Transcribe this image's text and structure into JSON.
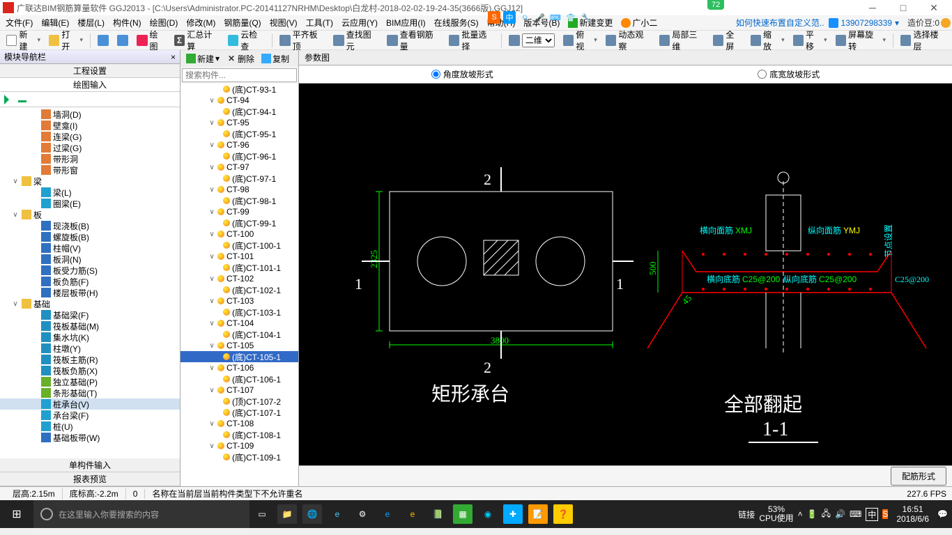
{
  "title": "广联达BIM钢筋算量软件 GGJ2013 - [C:\\Users\\Administrator.PC-20141127NRHM\\Desktop\\白龙村-2018-02-02-19-24-35(3666版).GGJ12]",
  "floatnum": "72",
  "menu": [
    "文件(F)",
    "编辑(E)",
    "楼层(L)",
    "构件(N)",
    "绘图(D)",
    "修改(M)",
    "钢筋量(Q)",
    "视图(V)",
    "工具(T)",
    "云应用(Y)",
    "BIM应用(I)",
    "在线服务(S)",
    "帮助(H)",
    "版本号(B)"
  ],
  "menu_link": "如何快速布置自定义范..",
  "menu_newbtn": "新建变更",
  "menu_gx": "广小二",
  "user_id": "13907298339",
  "bean_label": "造价豆:0",
  "toolbar1": {
    "new": "新建",
    "open": "打开",
    "draw": "绘图",
    "sum": "汇总计算",
    "cloud": "云检查",
    "flat": "平齐板顶",
    "find": "查找图元",
    "steel": "查看钢筋量",
    "batch": "批量选择",
    "dim": "二维",
    "bird": "俯视",
    "dyn": "动态观察",
    "local": "局部三维",
    "full": "全屏",
    "zoom": "缩放",
    "pan": "平移",
    "rot": "屏幕旋转",
    "floor": "选择楼层"
  },
  "leftpanel": {
    "title": "模块导航栏",
    "tab1": "工程设置",
    "tab2": "绘图输入"
  },
  "nav_items": [
    {
      "ind": 36,
      "ico": "#e27b38",
      "t": "墙洞(D)"
    },
    {
      "ind": 36,
      "ico": "#e27b38",
      "t": "壁龛(I)"
    },
    {
      "ind": 36,
      "ico": "#e27b38",
      "t": "连梁(G)"
    },
    {
      "ind": 36,
      "ico": "#e27b38",
      "t": "过梁(G)"
    },
    {
      "ind": 36,
      "ico": "#e27b38",
      "t": "带形洞"
    },
    {
      "ind": 36,
      "ico": "#e27b38",
      "t": "带形窗"
    },
    {
      "ind": 8,
      "exp": "∨",
      "ico": "#f0c040",
      "t": "梁",
      "folder": 1
    },
    {
      "ind": 36,
      "ico": "#20a0d0",
      "t": "梁(L)"
    },
    {
      "ind": 36,
      "ico": "#20a0d0",
      "t": "圈梁(E)"
    },
    {
      "ind": 8,
      "exp": "∨",
      "ico": "#f0c040",
      "t": "板",
      "folder": 1
    },
    {
      "ind": 36,
      "ico": "#3070c0",
      "t": "现浇板(B)"
    },
    {
      "ind": 36,
      "ico": "#3070c0",
      "t": "螺旋板(B)"
    },
    {
      "ind": 36,
      "ico": "#3070c0",
      "t": "柱帽(V)"
    },
    {
      "ind": 36,
      "ico": "#3070c0",
      "t": "板洞(N)"
    },
    {
      "ind": 36,
      "ico": "#3070c0",
      "t": "板受力筋(S)"
    },
    {
      "ind": 36,
      "ico": "#3070c0",
      "t": "板负筋(F)"
    },
    {
      "ind": 36,
      "ico": "#3070c0",
      "t": "楼层板带(H)"
    },
    {
      "ind": 8,
      "exp": "∨",
      "ico": "#f0c040",
      "t": "基础",
      "folder": 1
    },
    {
      "ind": 36,
      "ico": "#2090c0",
      "t": "基础梁(F)"
    },
    {
      "ind": 36,
      "ico": "#2090c0",
      "t": "筏板基础(M)"
    },
    {
      "ind": 36,
      "ico": "#2090c0",
      "t": "集水坑(K)"
    },
    {
      "ind": 36,
      "ico": "#2090c0",
      "t": "柱墩(Y)"
    },
    {
      "ind": 36,
      "ico": "#2090c0",
      "t": "筏板主筋(R)"
    },
    {
      "ind": 36,
      "ico": "#2090c0",
      "t": "筏板负筋(X)"
    },
    {
      "ind": 36,
      "ico": "#68b028",
      "t": "独立基础(P)"
    },
    {
      "ind": 36,
      "ico": "#68b028",
      "t": "条形基础(T)"
    },
    {
      "ind": 36,
      "ico": "#20a0d0",
      "t": "桩承台(V)",
      "sel": 1
    },
    {
      "ind": 36,
      "ico": "#20a0d0",
      "t": "承台梁(F)"
    },
    {
      "ind": 36,
      "ico": "#20a0d0",
      "t": "桩(U)"
    },
    {
      "ind": 36,
      "ico": "#3070c0",
      "t": "基础板带(W)"
    }
  ],
  "left_bottom": [
    "单构件输入",
    "报表预览"
  ],
  "mid": {
    "new": "新建",
    "del": "删除",
    "copy": "复制",
    "search_ph": "搜索构件..."
  },
  "comp_items": [
    {
      "lv": 3,
      "t": "(底)CT-93-1"
    },
    {
      "lv": 2,
      "exp": "∨",
      "t": "CT-94"
    },
    {
      "lv": 3,
      "t": "(底)CT-94-1"
    },
    {
      "lv": 2,
      "exp": "∨",
      "t": "CT-95"
    },
    {
      "lv": 3,
      "t": "(底)CT-95-1"
    },
    {
      "lv": 2,
      "exp": "∨",
      "t": "CT-96"
    },
    {
      "lv": 3,
      "t": "(底)CT-96-1"
    },
    {
      "lv": 2,
      "exp": "∨",
      "t": "CT-97"
    },
    {
      "lv": 3,
      "t": "(底)CT-97-1"
    },
    {
      "lv": 2,
      "exp": "∨",
      "t": "CT-98"
    },
    {
      "lv": 3,
      "t": "(底)CT-98-1"
    },
    {
      "lv": 2,
      "exp": "∨",
      "t": "CT-99"
    },
    {
      "lv": 3,
      "t": "(底)CT-99-1"
    },
    {
      "lv": 2,
      "exp": "∨",
      "t": "CT-100"
    },
    {
      "lv": 3,
      "t": "(底)CT-100-1"
    },
    {
      "lv": 2,
      "exp": "∨",
      "t": "CT-101"
    },
    {
      "lv": 3,
      "t": "(底)CT-101-1"
    },
    {
      "lv": 2,
      "exp": "∨",
      "t": "CT-102"
    },
    {
      "lv": 3,
      "t": "(底)CT-102-1"
    },
    {
      "lv": 2,
      "exp": "∨",
      "t": "CT-103"
    },
    {
      "lv": 3,
      "t": "(底)CT-103-1"
    },
    {
      "lv": 2,
      "exp": "∨",
      "t": "CT-104"
    },
    {
      "lv": 3,
      "t": "(底)CT-104-1"
    },
    {
      "lv": 2,
      "exp": "∨",
      "t": "CT-105"
    },
    {
      "lv": 3,
      "t": "(底)CT-105-1",
      "sel": 1
    },
    {
      "lv": 2,
      "exp": "∨",
      "t": "CT-106"
    },
    {
      "lv": 3,
      "t": "(底)CT-106-1"
    },
    {
      "lv": 2,
      "exp": "∨",
      "t": "CT-107"
    },
    {
      "lv": 3,
      "t": "(顶)CT-107-2"
    },
    {
      "lv": 3,
      "t": "(底)CT-107-1"
    },
    {
      "lv": 2,
      "exp": "∨",
      "t": "CT-108"
    },
    {
      "lv": 3,
      "t": "(底)CT-108-1"
    },
    {
      "lv": 2,
      "exp": "∨",
      "t": "CT-109"
    },
    {
      "lv": 3,
      "t": "(底)CT-109-1"
    }
  ],
  "right": {
    "tab": "参数图",
    "radio1": "角度放坡形式",
    "radio2": "底宽放坡形式",
    "btn": "配筋形式"
  },
  "cad": {
    "left_title": "矩形承台",
    "w": "3800",
    "h": "2325",
    "m1": "1",
    "m2": "2",
    "right_title": "全部翻起",
    "right_sub": "1-1",
    "dim500": "500",
    "dim45": "45",
    "lbl1": "横向面筋",
    "lbl1v": "XMJ",
    "lbl2": "纵向面筋",
    "lbl2v": "YMJ",
    "lbl3": "横向底筋",
    "lbl3v": "C25@200",
    "lbl4": "纵向底筋",
    "lbl4v": "C25@200",
    "lbl5v": "C25@200",
    "lbl5": "节点设置"
  },
  "status": {
    "floor": "层高:2.15m",
    "bot": "底标高:-2.2m",
    "zero": "0",
    "msg": "名称在当前层当前构件类型下不允许重名",
    "fps": "227.6 FPS"
  },
  "taskbar": {
    "search": "在这里输入你要搜索的内容",
    "link": "链接",
    "cpu": "53%",
    "cpulbl": "CPU使用",
    "time": "16:51",
    "date": "2018/6/6",
    "ime": "中"
  }
}
